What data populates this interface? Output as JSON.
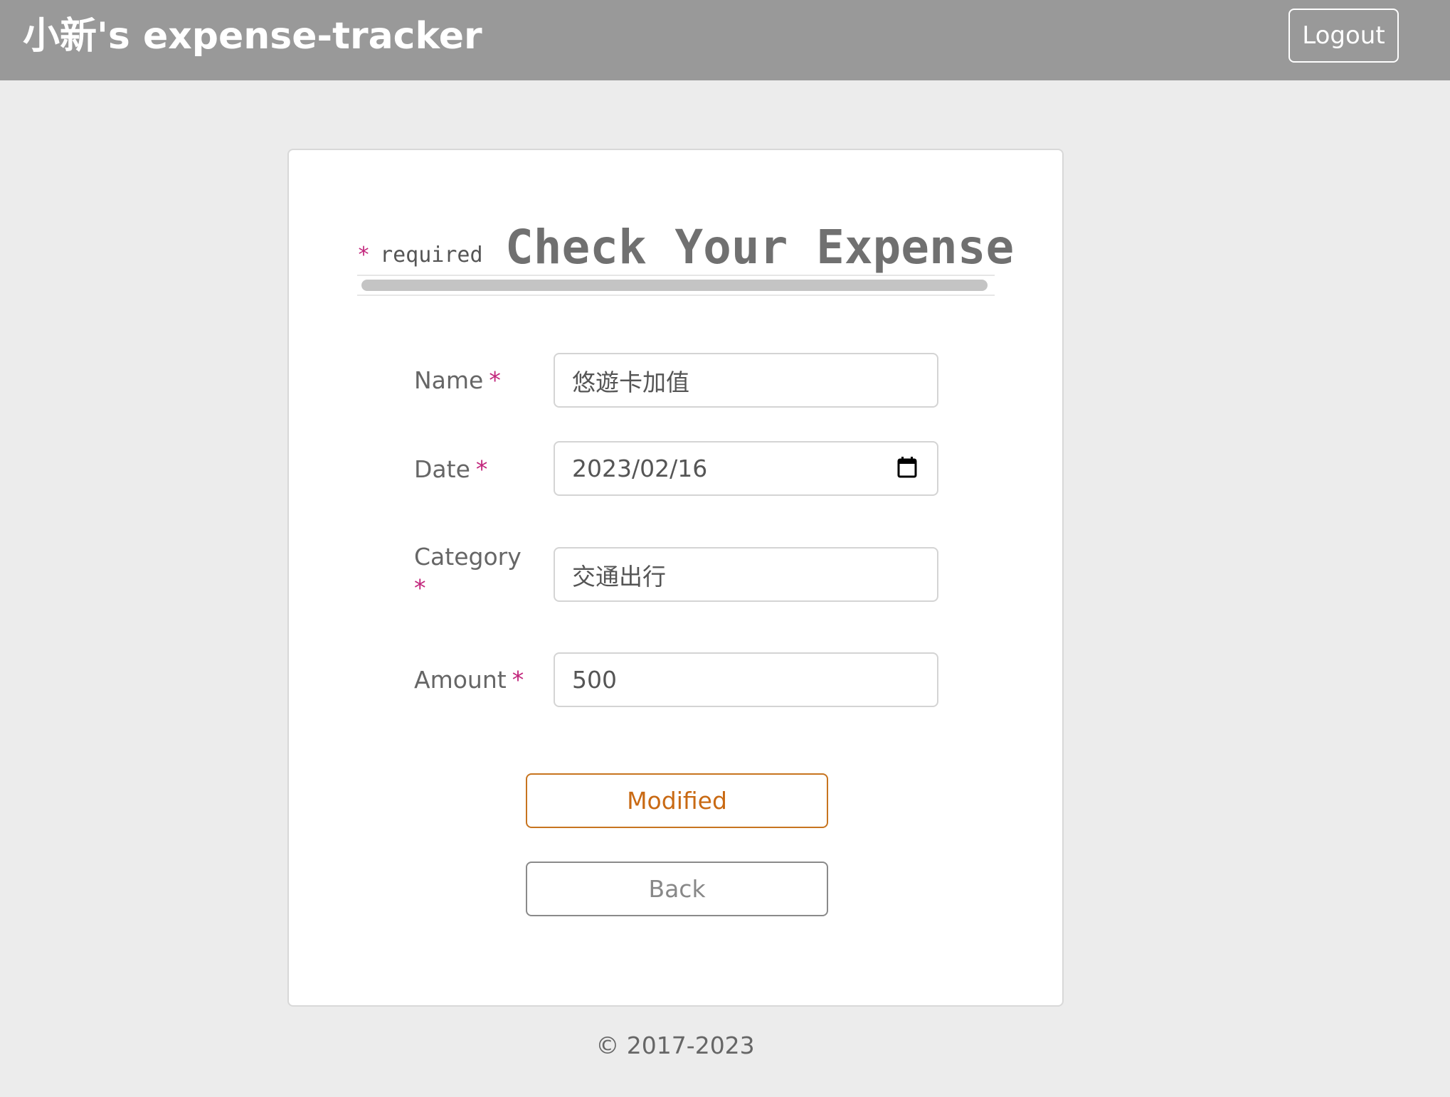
{
  "navbar": {
    "brand": "小新's expense-tracker",
    "logout_label": "Logout"
  },
  "form": {
    "required_star": "*",
    "required_label": "required",
    "title": "Check Your Expense",
    "fields": {
      "name": {
        "label": "Name",
        "value": "悠遊卡加值"
      },
      "date": {
        "label": "Date",
        "value": "2023/02/16"
      },
      "category": {
        "label": "Category",
        "value": "交通出行"
      },
      "amount": {
        "label": "Amount",
        "value": "500"
      }
    },
    "submit_label": "Modified",
    "back_label": "Back"
  },
  "icons": {
    "date_picker": "calendar-icon"
  },
  "colors": {
    "navbar": "#999999",
    "required_star": "#c2267c",
    "modified_accent": "#c96a14"
  },
  "footer": {
    "copyright": "© 2017-2023"
  }
}
